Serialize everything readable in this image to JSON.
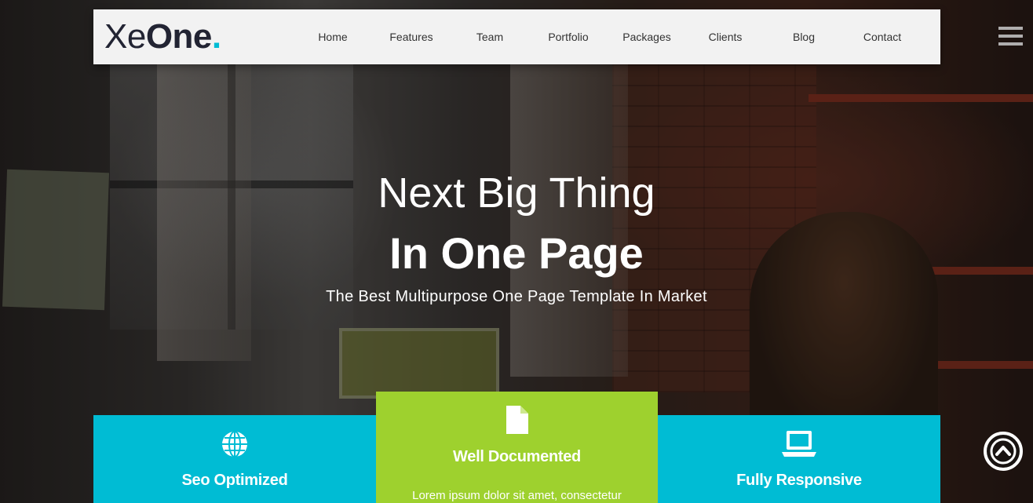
{
  "brand": {
    "logo_part1": "Xe",
    "logo_part2": "One",
    "logo_dot": ".",
    "accent": "#00bcd4"
  },
  "nav": {
    "items": [
      "Home",
      "Features",
      "Team",
      "Portfolio",
      "Packages",
      "Clients",
      "Blog",
      "Contact"
    ]
  },
  "hero": {
    "title_line1": "Next Big Thing",
    "title_line2": "In One Page",
    "subtitle": "The Best Multipurpose One Page Template In Market"
  },
  "features": [
    {
      "icon": "globe-icon",
      "title": "Seo Optimized",
      "text": "",
      "color": "#00bcd4"
    },
    {
      "icon": "document-icon",
      "title": "Well Documented",
      "text": "Lorem ipsum dolor sit amet, consectetur",
      "color": "#9ed12e"
    },
    {
      "icon": "laptop-icon",
      "title": "Fully Responsive",
      "text": "",
      "color": "#00bcd4"
    }
  ],
  "icons": {
    "menu": "hamburger-icon",
    "scroll_top": "chevron-up-circle-icon"
  }
}
